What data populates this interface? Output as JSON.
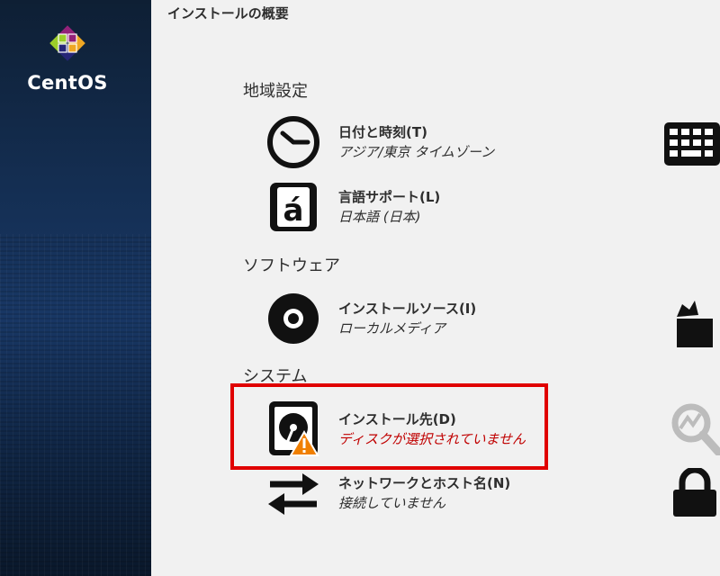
{
  "app": {
    "logo_text": "CentOS"
  },
  "header": {
    "title": "インストールの概要"
  },
  "sections": [
    {
      "header": "地域設定",
      "spokes": [
        {
          "title": "日付と時刻(T)",
          "status": "アジア/東京 タイムゾーン",
          "icon": "clock-icon"
        },
        {
          "title": "言語サポート(L)",
          "status": "日本語 (日本)",
          "icon": "language-icon"
        }
      ]
    },
    {
      "header": "ソフトウェア",
      "spokes": [
        {
          "title": "インストールソース(I)",
          "status": "ローカルメディア",
          "icon": "disc-icon"
        }
      ]
    },
    {
      "header": "システム",
      "spokes": [
        {
          "title": "インストール先(D)",
          "status": "ディスクが選択されていません",
          "icon": "hard-drive-icon",
          "warning": true
        },
        {
          "title": "ネットワークとホスト名(N)",
          "status": "接続していません",
          "icon": "network-arrows-icon"
        }
      ]
    }
  ],
  "right_icons": [
    "keyboard-icon",
    "package-icon",
    "search-icon",
    "lock-icon"
  ],
  "colors": {
    "warning_text": "#c00000",
    "highlight_border": "#e00000",
    "sidebar_dark": "#0e1f34"
  }
}
